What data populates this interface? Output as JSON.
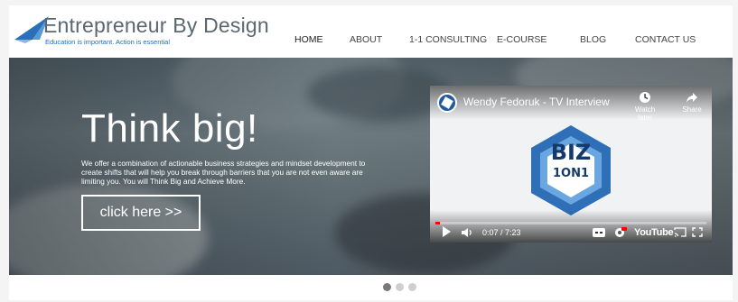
{
  "brand": {
    "name": "Entrepreneur By Design",
    "tagline": "Education is important. Action is essential",
    "logo_icon": "paper-plane-icon"
  },
  "nav": {
    "items": [
      {
        "label": "HOME",
        "active": true
      },
      {
        "label": "ABOUT",
        "active": false
      },
      {
        "label": "1-1 CONSULTING",
        "active": false
      },
      {
        "label": "E-COURSE",
        "active": false
      },
      {
        "label": "BLOG",
        "active": false
      },
      {
        "label": "CONTACT US",
        "active": false
      }
    ]
  },
  "hero": {
    "title": "Think big!",
    "text": "We offer a combination of actionable business strategies and mindset development to create shifts that will help you break through barriers that you are not even aware are limiting you. You will Think Big and Achieve More.",
    "cta_label": "click here >>"
  },
  "video": {
    "title": "Wendy Fedoruk - TV Interview",
    "watch_later_label": "Watch later",
    "share_label": "Share",
    "thumbnail_line1": "BIZ",
    "thumbnail_line2": "1ON1",
    "time": "0:07 / 7:23",
    "progress_fraction": 0.016,
    "platform": "YouTube",
    "accent_color": "#ff0000"
  },
  "slider": {
    "dots": [
      {
        "active": true
      },
      {
        "active": false
      },
      {
        "active": false
      }
    ]
  },
  "colors": {
    "brand_blue": "#1b6fc2",
    "brand_gray": "#5b6770",
    "biz_blue": "#2f6fb8"
  }
}
